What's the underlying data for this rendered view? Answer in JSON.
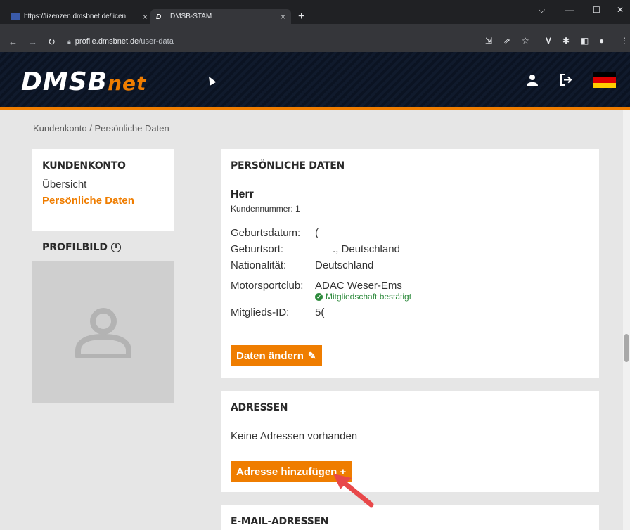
{
  "browser": {
    "tabs": [
      {
        "title": "https://lizenzen.dmsbnet.de/licen",
        "close": "×"
      },
      {
        "title": "DMSB-STAM",
        "close": "×"
      }
    ],
    "new_tab": "+",
    "url_host": "profile.dmsbnet.de",
    "url_path": "/user-data",
    "window_controls": [
      "⌵",
      "—",
      "☐",
      "✕"
    ]
  },
  "header": {
    "logo_main": "DMSB",
    "logo_net": "net",
    "flag_colors": [
      "#000000",
      "#dd0000",
      "#ffce00"
    ]
  },
  "breadcrumb": "Kundenkonto / Persönliche Daten",
  "sidebar": {
    "title": "Kundenkonto",
    "items": [
      {
        "label": "Übersicht",
        "active": false
      },
      {
        "label": "Persönliche Daten",
        "active": true
      }
    ],
    "profile_title": "Profilbild",
    "profile_info_icon": "i"
  },
  "personal": {
    "title": "Persönliche Daten",
    "salutation": "Herr",
    "customer_number": "Kundennummer: 1",
    "fields": [
      {
        "label": "Geburtsdatum:",
        "value": "("
      },
      {
        "label": "Geburtsort:",
        "value": "___., Deutschland"
      },
      {
        "label": "Nationalität:",
        "value": "Deutschland"
      },
      {
        "label": "Motorsportclub:",
        "value": "ADAC Weser-Ems"
      }
    ],
    "membership_status": "Mitgliedschaft bestätigt",
    "member_id_label": "Mitglieds-ID:",
    "member_id_value": "5(",
    "edit_button": "Daten ändern"
  },
  "addresses": {
    "title": "Adressen",
    "empty_text": "Keine Adressen vorhanden",
    "add_button": "Adresse hinzufügen +"
  },
  "emails": {
    "title": "E-Mail-Adressen"
  },
  "colors": {
    "accent": "#ef7d00",
    "success": "#2e8b3d",
    "annotation_arrow": "#e8484a"
  }
}
